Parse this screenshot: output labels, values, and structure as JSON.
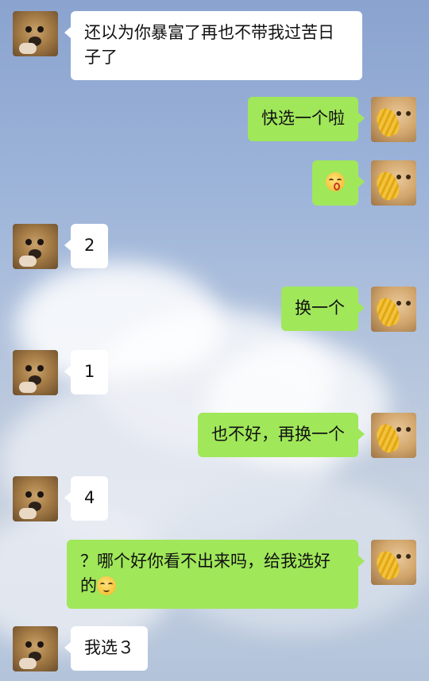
{
  "messages": [
    {
      "side": "left",
      "text": "还以为你暴富了再也不带我过苦日子了"
    },
    {
      "side": "right",
      "text": "快选一个啦"
    },
    {
      "side": "right",
      "emoji": "kissing-face-emoji"
    },
    {
      "side": "left",
      "text": "2"
    },
    {
      "side": "right",
      "text": "换一个"
    },
    {
      "side": "left",
      "text": "1"
    },
    {
      "side": "right",
      "text": "也不好，再换一个"
    },
    {
      "side": "left",
      "text": "4"
    },
    {
      "side": "right",
      "text": "？哪个好你看不出来吗，给我选好的",
      "emoji": "smiling-face-emoji"
    },
    {
      "side": "left",
      "text": "我选３"
    }
  ],
  "avatars": {
    "left": "puppy-avatar",
    "right": "cat-with-bread-avatar"
  },
  "colors": {
    "left_bubble": "#ffffff",
    "right_bubble": "#a0e75a"
  }
}
